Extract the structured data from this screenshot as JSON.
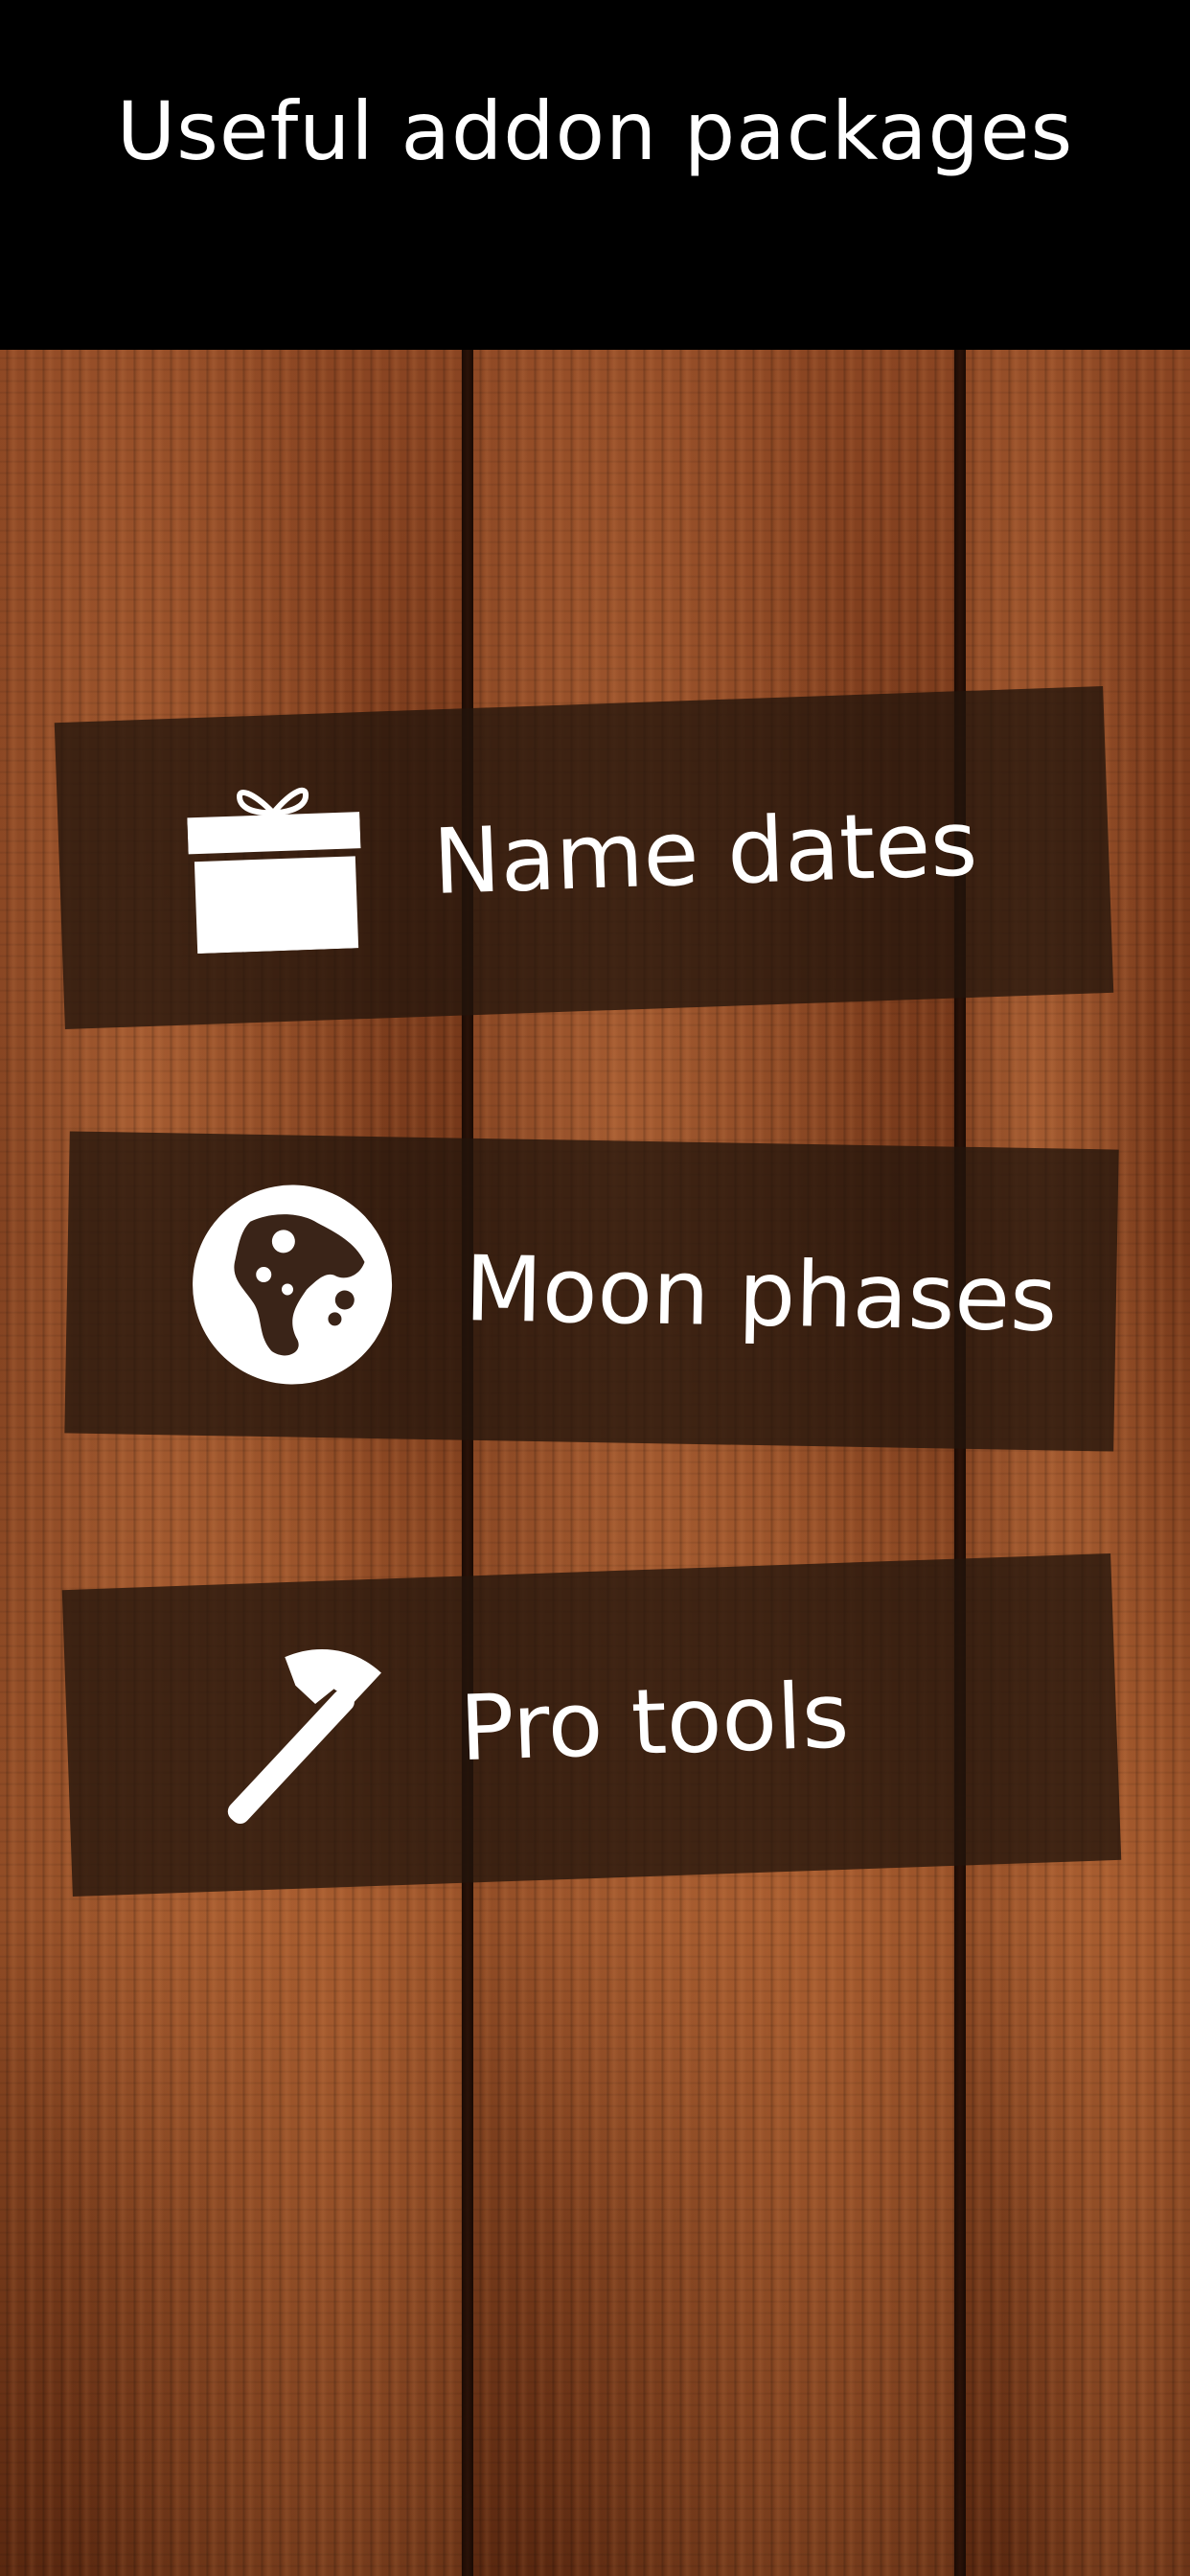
{
  "header": {
    "title": "Useful addon packages"
  },
  "items": [
    {
      "id": "name-dates",
      "label": "Name dates",
      "icon": "gift-icon"
    },
    {
      "id": "moon-phases",
      "label": "Moon phases",
      "icon": "moon-icon"
    },
    {
      "id": "pro-tools",
      "label": "Pro tools",
      "icon": "hammer-icon"
    }
  ],
  "colors": {
    "header_bg": "#000000",
    "text": "#ffffff",
    "card_bg": "#23140c",
    "wood": "#7a3d1c"
  }
}
